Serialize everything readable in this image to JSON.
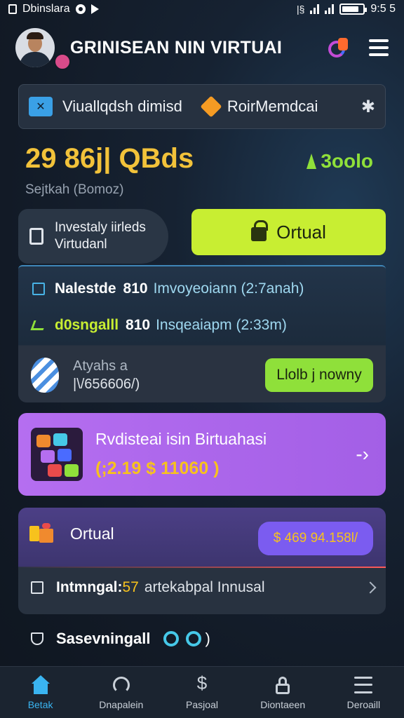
{
  "status_bar": {
    "app_label": "Dbinslara",
    "time": "9:5 5"
  },
  "header": {
    "title": "GRINISEAN NIN VIRTUAI"
  },
  "tabs": {
    "tab1": "Viuallqdsh dimisd",
    "tab2": "RoirMemdcai"
  },
  "balance": {
    "amount": "29 86j| QBds",
    "subtitle": "Sejtkah (Bomoz)",
    "gain": "3oolo"
  },
  "invest": {
    "line1": "Investaly iirleds",
    "line2": "Virtudanl",
    "button_label": "Ortual"
  },
  "transactions": [
    {
      "name": "Nalestde",
      "amount": "810",
      "info": "Imvoyeoiann (2:7anah)"
    },
    {
      "name": "d0sngalll",
      "amount": "810",
      "info": "Insqeaiapm (2:33m)"
    }
  ],
  "promo_row": {
    "line1": "Atyahs a",
    "line2": "|\\/656606/)",
    "button_label": "Llolb j nowny"
  },
  "promo_card": {
    "title": "Rvdisteai isin Birtuahasi",
    "amount": "(;2.19 $ 11060 )"
  },
  "wallet": {
    "label": "Ortual",
    "pill_value": "$ 469 94.158l/",
    "row_label": "Intmngal:",
    "row_num": "57",
    "row_desc": "artekabpal Innusal"
  },
  "savings": {
    "label": "Sasevningall",
    "paren": ")"
  },
  "bottom_nav": [
    {
      "label": "Betak",
      "icon": "home-icon"
    },
    {
      "label": "Dnapalein",
      "icon": "chart-icon"
    },
    {
      "label": "Pasjoal",
      "icon": "dollar-icon"
    },
    {
      "label": "Diontaeen",
      "icon": "lock-icon"
    },
    {
      "label": "Deroaill",
      "icon": "menu-icon"
    }
  ],
  "colors": {
    "accent_lime": "#c8ee32",
    "accent_gold": "#f2c23a",
    "accent_purple": "#b56ef0",
    "accent_blue": "#3ab4f0"
  }
}
